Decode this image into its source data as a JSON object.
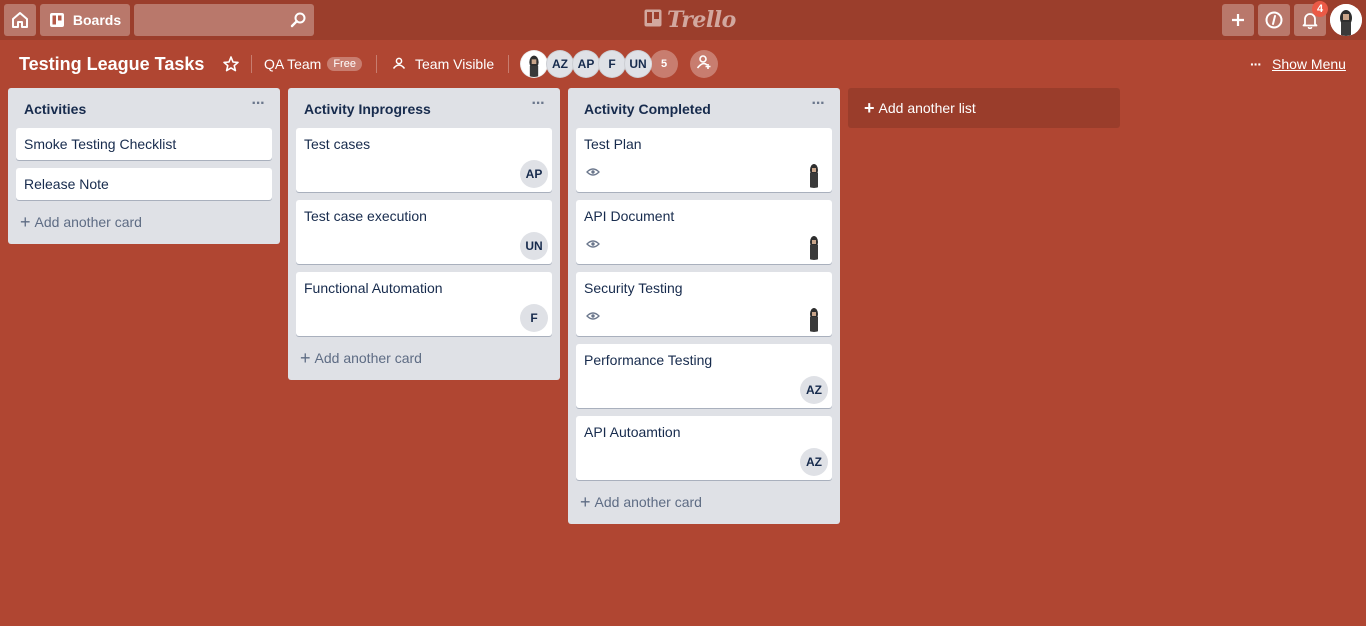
{
  "header": {
    "home_icon": "home-icon",
    "boards_label": "Boards",
    "search_placeholder": "",
    "logo_text": "Trello",
    "notification_count": "4"
  },
  "board": {
    "title": "Testing League Tasks",
    "team_name": "QA Team",
    "team_plan": "Free",
    "visibility": "Team Visible",
    "members": [
      "AZ",
      "AP",
      "F",
      "UN"
    ],
    "more_members": "5",
    "show_menu_label": "Show Menu"
  },
  "lists": [
    {
      "title": "Activities",
      "cards": [
        {
          "title": "Smoke Testing Checklist"
        },
        {
          "title": "Release Note"
        }
      ],
      "add_card_label": "Add another card"
    },
    {
      "title": "Activity Inprogress",
      "cards": [
        {
          "title": "Test cases",
          "member": "AP"
        },
        {
          "title": "Test case execution",
          "member": "UN"
        },
        {
          "title": "Functional Automation",
          "member": "F"
        }
      ],
      "add_card_label": "Add another card"
    },
    {
      "title": "Activity Completed",
      "cards": [
        {
          "title": "Test Plan",
          "watching": true
        },
        {
          "title": "API Document",
          "watching": true
        },
        {
          "title": "Security Testing",
          "watching": true
        },
        {
          "title": "Performance Testing",
          "member": "AZ"
        },
        {
          "title": "API Autoamtion",
          "member": "AZ"
        }
      ],
      "add_card_label": "Add another card"
    }
  ],
  "add_list_label": "Add another list",
  "colors": {
    "board_background": "#b04632",
    "header_background": "#9b3e2c",
    "list_background": "#dfe1e6",
    "notification_badge": "#eb5a46"
  }
}
